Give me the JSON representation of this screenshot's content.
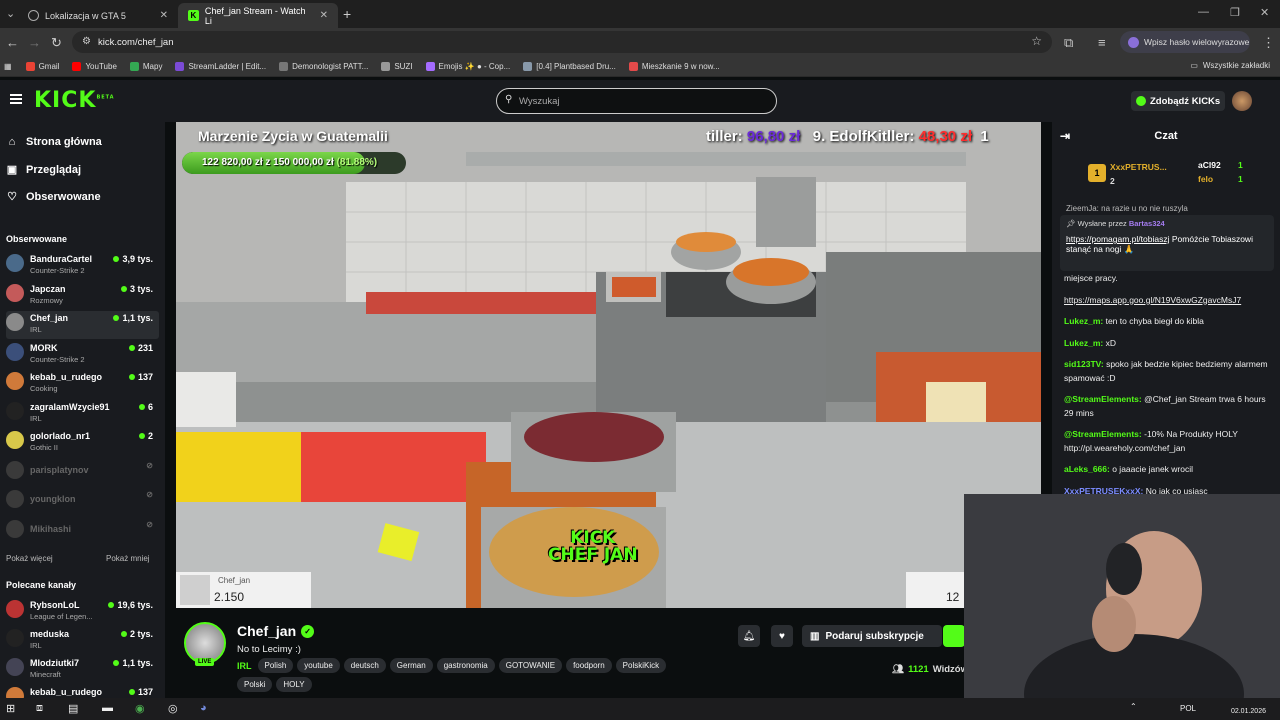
{
  "browser": {
    "tabs": [
      {
        "label": "Lokalizacja w GTA 5",
        "active": false
      },
      {
        "label": "Chef_jan Stream - Watch Li",
        "active": true
      }
    ],
    "url": "kick.com/chef_jan",
    "profile_label": "Wpisz hasło wielowyrazowe",
    "bookmarks": [
      {
        "label": "Gmail",
        "color": "#ea4335"
      },
      {
        "label": "YouTube",
        "color": "#ff0000"
      },
      {
        "label": "Mapy",
        "color": "#34a853"
      },
      {
        "label": "StreamLadder | Edit...",
        "color": "#7b4bd6"
      },
      {
        "label": "Demonologist PATT...",
        "color": "#777777"
      },
      {
        "label": "SUZI",
        "color": "#999999"
      },
      {
        "label": "Emojis ✨ ● - Cop...",
        "color": "#a46bff"
      },
      {
        "label": "[0.4] Plantbased Dru...",
        "color": "#8899aa"
      },
      {
        "label": "Mieszkanie 9 w now...",
        "color": "#e34a4a"
      }
    ],
    "all_bookmarks": "Wszystkie zakładki"
  },
  "kick": {
    "search_placeholder": "Wyszukaj",
    "get_kicks": "Zdobądź KICKs",
    "nav": [
      {
        "label": "Strona główna",
        "icon": "home-icon"
      },
      {
        "label": "Przeglądaj",
        "icon": "browse-icon"
      },
      {
        "label": "Obserwowane",
        "icon": "heart-icon"
      }
    ],
    "followed_header": "Obserwowane",
    "followed": [
      {
        "name": "BanduraCartel",
        "category": "Counter-Strike 2",
        "viewers": "3,9 tys.",
        "color": "#4a6a8a",
        "live": true
      },
      {
        "name": "Japczan",
        "category": "Rozmowy",
        "viewers": "3 tys.",
        "color": "#c45a5a",
        "live": true
      },
      {
        "name": "Chef_jan",
        "category": "IRL",
        "viewers": "1,1 tys.",
        "color": "#8a8a8a",
        "live": true
      },
      {
        "name": "MORK",
        "category": "Counter-Strike 2",
        "viewers": "231",
        "color": "#3b4f7a",
        "live": true
      },
      {
        "name": "kebab_u_rudego",
        "category": "Cooking",
        "viewers": "137",
        "color": "#d07a3a",
        "live": true
      },
      {
        "name": "zagralamWzycie91",
        "category": "IRL",
        "viewers": "6",
        "color": "#222222",
        "live": true
      },
      {
        "name": "golorlado_nr1",
        "category": "Gothic II",
        "viewers": "2",
        "color": "#d8c84a",
        "live": true
      },
      {
        "name": "parisplatynov",
        "category": "",
        "viewers": "",
        "color": "#3a3a3a",
        "live": false
      },
      {
        "name": "youngklon",
        "category": "",
        "viewers": "",
        "color": "#3a3a3a",
        "live": false
      },
      {
        "name": "Mikihashi",
        "category": "",
        "viewers": "",
        "color": "#3a3a3a",
        "live": false
      }
    ],
    "show_more": "Pokaż więcej",
    "show_less": "Pokaż mniej",
    "recommended_header": "Polecane kanały",
    "recommended": [
      {
        "name": "RybsonLoL",
        "category": "League of Legen...",
        "viewers": "19,6 tys.",
        "color": "#b33"
      },
      {
        "name": "meduska",
        "category": "IRL",
        "viewers": "2 tys.",
        "color": "#222"
      },
      {
        "name": "Mlodziutki7",
        "category": "Minecraft",
        "viewers": "1,1 tys.",
        "color": "#445"
      },
      {
        "name": "kebab_u_rudego",
        "category": "",
        "viewers": "137",
        "color": "#d07a3a"
      }
    ]
  },
  "stream": {
    "overlay_title": "Marzenie Zycia w Guatemalii",
    "goal_text": "122 820,00 zł z 150 000,00 zł",
    "goal_percent_text": "(81.88%)",
    "goal_fraction": 0.8188,
    "ticker_a": "tiller:",
    "ticker_a_amt": "96,80 zł",
    "ticker_b": "9. EdolfKitller:",
    "ticker_b_amt": "48,30 zł",
    "ticker_c": "1",
    "watermark_1": "KICK",
    "watermark_2": "CHEF JAN",
    "card_name": "Chef_jan",
    "card_value": "2.150",
    "card2_value": "12",
    "streamer": "Chef_jan",
    "title": "No to Lecimy :)",
    "category": "IRL",
    "tags": [
      "Polish",
      "youtube",
      "deutsch",
      "German",
      "gastronomia",
      "GOTOWANIE",
      "foodporn",
      "PolskiKick",
      "Polski",
      "HOLY"
    ],
    "subscribe_label": "Podaruj subskrypcje",
    "viewers": "1121",
    "viewers_label": "Widzów",
    "live_badge": "LIVE"
  },
  "chat": {
    "header": "Czat",
    "leader1_name": "XxxPETRUS...",
    "leader1_rank": "1",
    "leader1_count": "2",
    "leader2_name": "aCl92",
    "leader2_count": "1",
    "leader3_name": "felo",
    "leader3_count": "1",
    "cut_line": "ZieemJa: na razie u no nie ruszyla",
    "pinned_by": "Wysłane przez",
    "pinned_user": "Bartas324",
    "pinned_link": "https://pomagam.pl/tobiaszj",
    "pinned_text": "Pomóżcie Tobiaszowi stanąć na nogi 🙏",
    "messages": [
      {
        "user": "",
        "text": "miejsce pracy.",
        "color": "#ffffff"
      },
      {
        "user": "",
        "text": "https://maps.app.goo.gl/N19V6xwGZgavcMsJ7",
        "color": "#ffffff"
      },
      {
        "user": "Lukez_m:",
        "text": "ten to chyba biegł do kibla",
        "color": "#53fc18"
      },
      {
        "user": "Lukez_m:",
        "text": "xD",
        "color": "#53fc18"
      },
      {
        "user": "sid123TV:",
        "text": "spoko jak bedzie kipiec bedziemy alarmem spamować :D",
        "color": "#53fc18"
      },
      {
        "user": "@StreamElements:",
        "text": "@Chef_jan Stream trwa 6 hours 29 mins",
        "color": "#53fc18"
      },
      {
        "user": "@StreamElements:",
        "text": "-10% Na Produkty HOLY http://pl.weareholy.com/chef_jan",
        "color": "#53fc18"
      },
      {
        "user": "aLeks_666:",
        "text": "o jaaacie janek wrocil",
        "color": "#53fc18"
      },
      {
        "user": "XxxPETRUSEKxxX:",
        "text": "No jak co usiasc",
        "color": "#7b8cff"
      }
    ]
  },
  "taskbar": {
    "lang": "POL",
    "date": "02.01.2026"
  }
}
